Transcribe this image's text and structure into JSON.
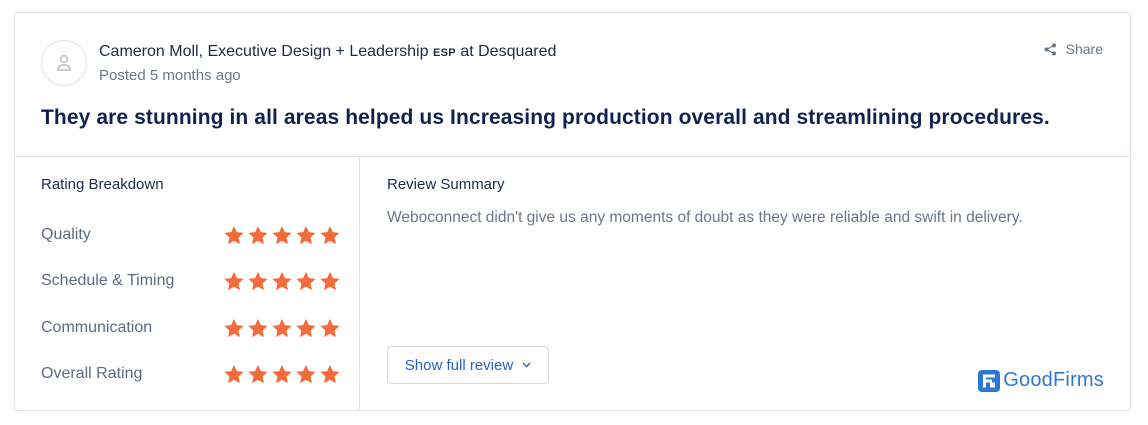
{
  "reviewer": {
    "name_prefix": "Cameron Moll, Executive Design + Leadership ",
    "name_esp": "ESP",
    "name_suffix": " at Desquared",
    "posted": "Posted 5 months ago"
  },
  "share_label": "Share",
  "headline": "They are stunning in all areas helped us Increasing production overall and streamlining procedures.",
  "breakdown": {
    "title": "Rating Breakdown",
    "star_color": "#f26b3a",
    "rows": [
      {
        "label": "Quality",
        "stars": 5
      },
      {
        "label": "Schedule & Timing",
        "stars": 5
      },
      {
        "label": "Communication",
        "stars": 5
      },
      {
        "label": "Overall Rating",
        "stars": 5
      }
    ]
  },
  "summary": {
    "title": "Review Summary",
    "text": "Weboconnect didn't give us any moments of doubt as they were reliable and swift in delivery."
  },
  "show_full_review_label": "Show full review",
  "brand": {
    "name": "GoodFirms",
    "color": "#2f77d6"
  },
  "icons": [
    "user-icon",
    "share-icon",
    "star-icon",
    "chevron-down-icon",
    "goodfirms-logo-icon"
  ]
}
